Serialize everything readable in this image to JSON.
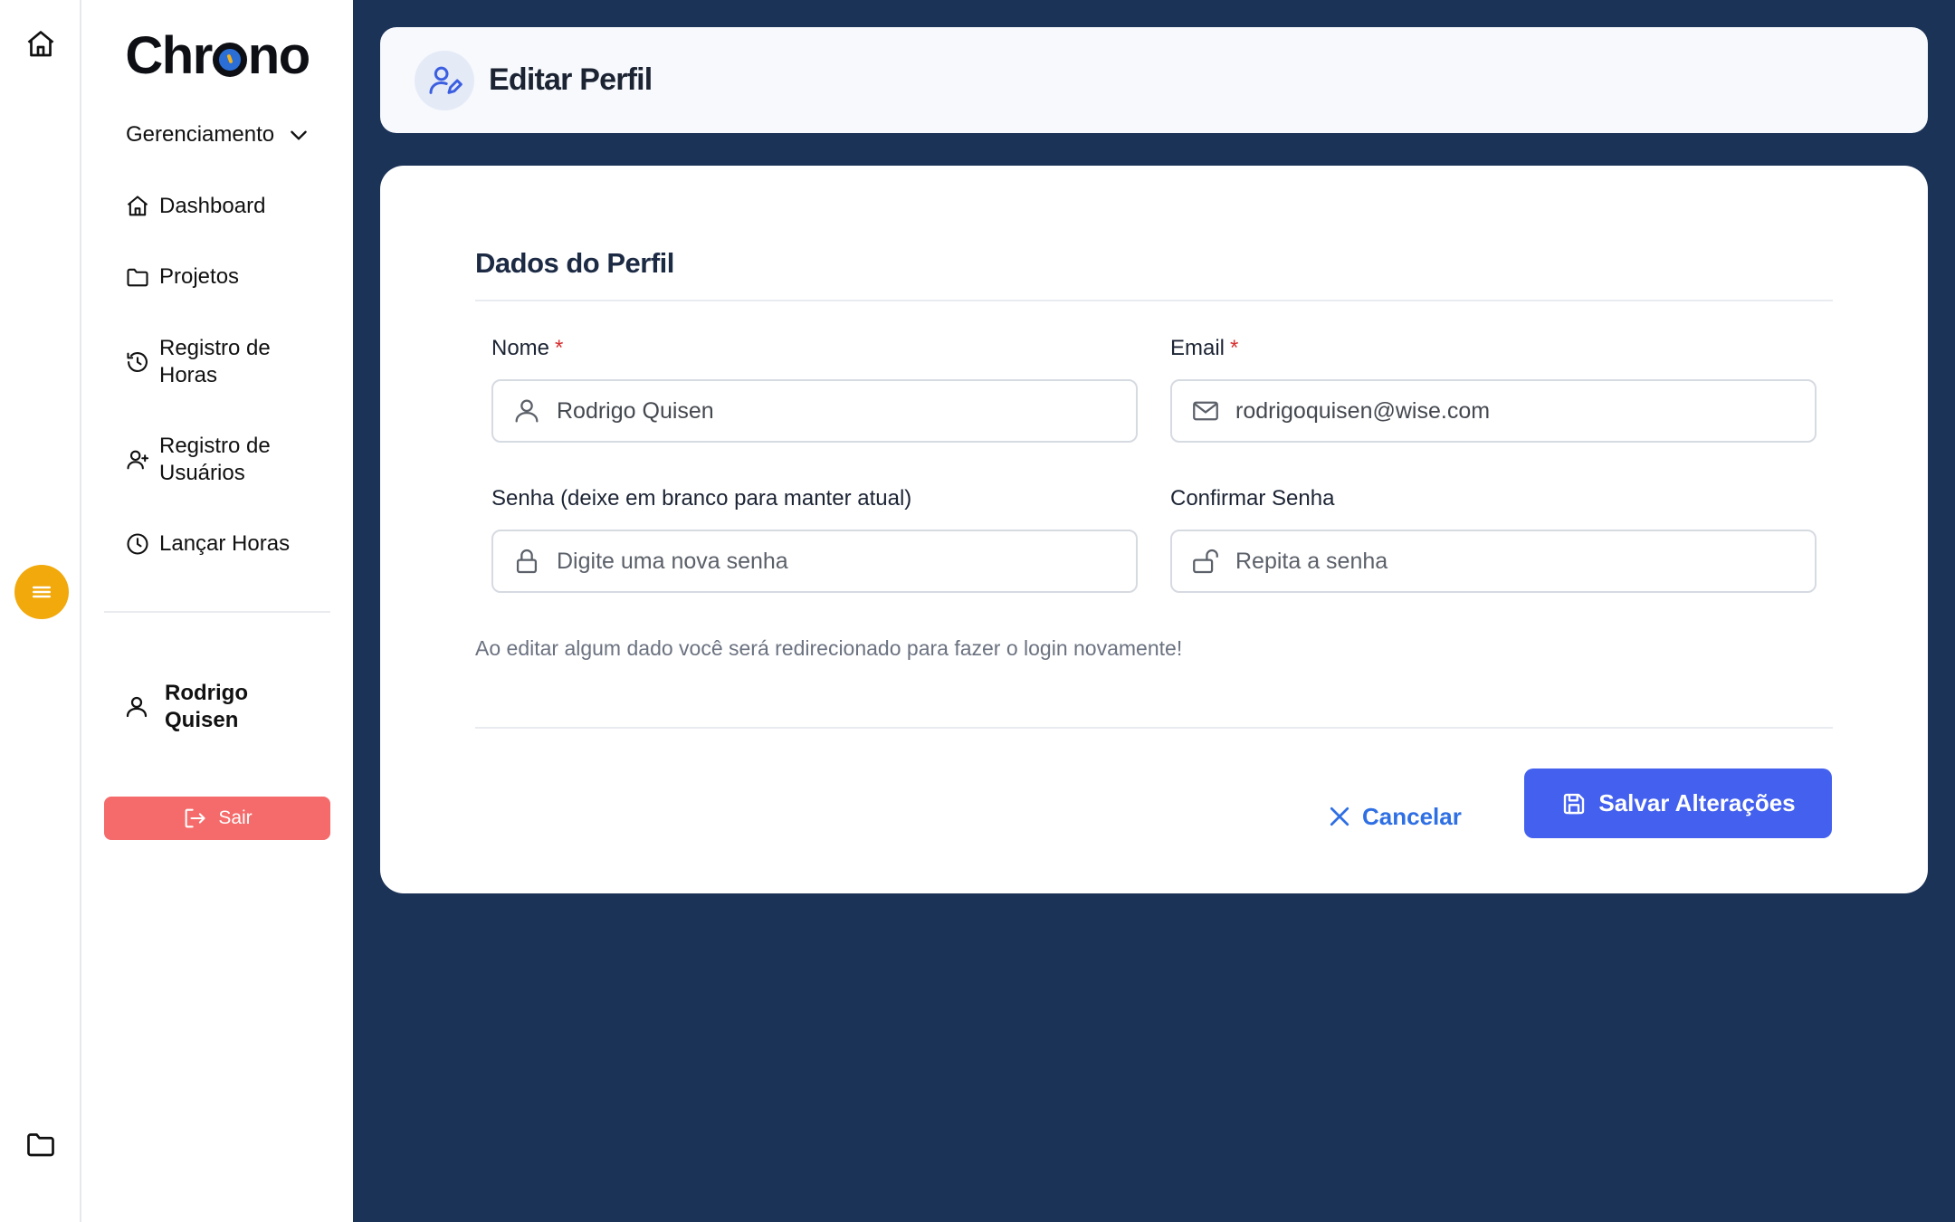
{
  "app": {
    "logo_text_start": "Chr",
    "logo_text_end": "no"
  },
  "sidebar": {
    "section_label": "Gerenciamento",
    "items": [
      {
        "label": "Dashboard",
        "icon": "home-icon"
      },
      {
        "label": "Projetos",
        "icon": "folder-icon"
      },
      {
        "label": "Registro de Horas",
        "icon": "history-icon"
      },
      {
        "label": "Registro de Usuários",
        "icon": "user-plus-icon"
      },
      {
        "label": "Lançar Horas",
        "icon": "clock-icon"
      }
    ],
    "user_name": "Rodrigo Quisen",
    "logout_label": "Sair"
  },
  "header": {
    "title": "Editar Perfil",
    "icon": "user-edit-icon"
  },
  "form": {
    "title": "Dados do Perfil",
    "name_label": "Nome",
    "name_value": "Rodrigo Quisen",
    "email_label": "Email",
    "email_value": "rodrigoquisen@wise.com",
    "required_mark": "*",
    "password_label": "Senha (deixe em branco para manter atual)",
    "password_placeholder": "Digite uma nova senha",
    "confirm_label": "Confirmar Senha",
    "confirm_placeholder": "Repita a senha",
    "hint": "Ao editar algum dado você será redirecionado para fazer o login novamente!",
    "cancel_label": "Cancelar",
    "save_label": "Salvar Alterações"
  },
  "colors": {
    "background": "#1c3358",
    "accent": "#4360ee",
    "menu_button": "#f1a90c",
    "logout": "#f56a6a",
    "required": "#d63031"
  }
}
